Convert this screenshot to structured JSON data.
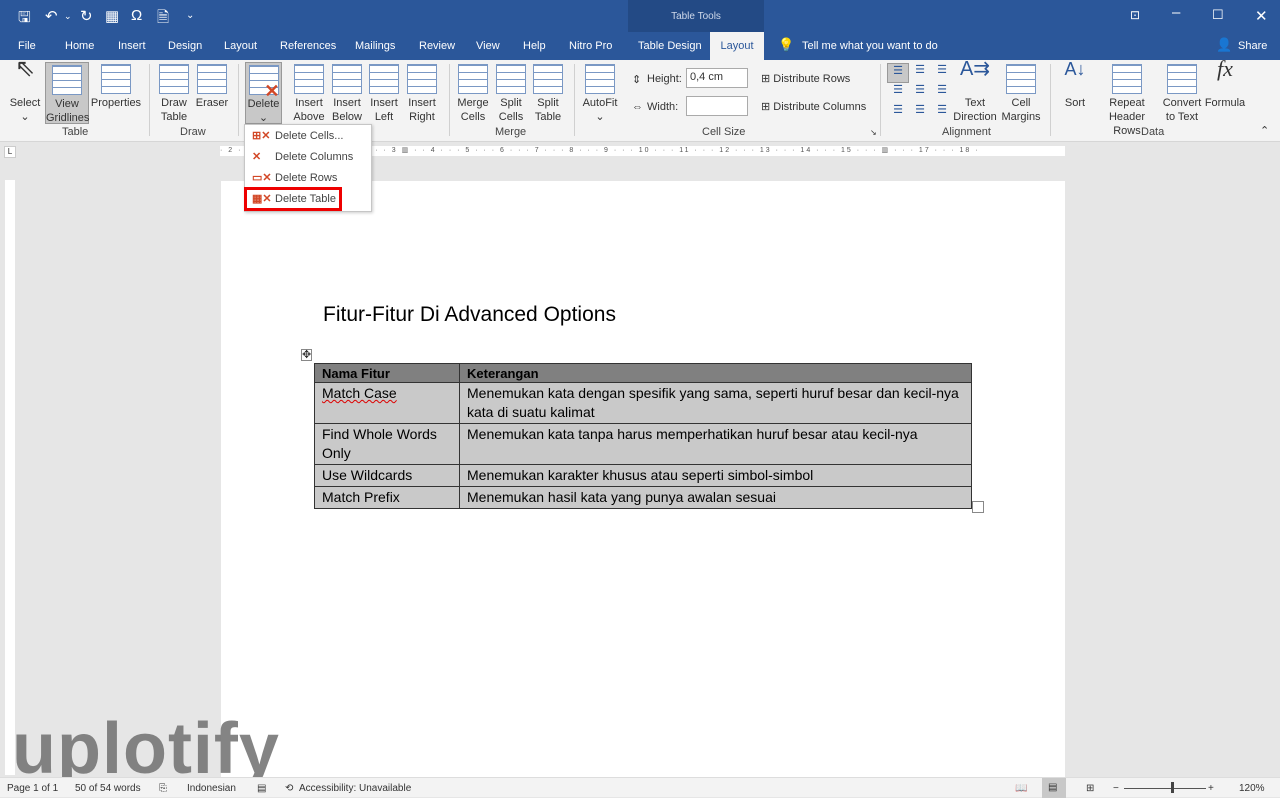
{
  "titlebar": {
    "context_tab": "Table Tools",
    "controls": [
      "restore-ribbon-icon",
      "minimize-icon",
      "maximize-icon",
      "close-icon"
    ]
  },
  "quick_access": [
    "save-icon",
    "undo-icon",
    "redo-icon",
    "table-icon",
    "omega-icon",
    "document-icon",
    "customize-icon"
  ],
  "tabs": [
    "File",
    "Home",
    "Insert",
    "Design",
    "Layout",
    "References",
    "Mailings",
    "Review",
    "View",
    "Help",
    "Nitro Pro",
    "Table Design",
    "Layout"
  ],
  "active_tab": "Layout",
  "tell_me": "Tell me what you want to do",
  "share": "Share",
  "ribbon": {
    "table": {
      "label": "Table",
      "select": "Select",
      "view_gridlines": "View Gridlines",
      "properties": "Properties"
    },
    "draw": {
      "label": "Draw",
      "draw_table": "Draw Table",
      "eraser": "Eraser"
    },
    "rows_cols": {
      "delete": "Delete",
      "insert_above": "Insert Above",
      "insert_below": "Insert Below",
      "insert_left": "Insert Left",
      "insert_right": "Insert Right"
    },
    "merge": {
      "label": "Merge",
      "merge_cells": "Merge Cells",
      "split_cells": "Split Cells",
      "split_table": "Split Table"
    },
    "cell_size": {
      "label": "Cell Size",
      "autofit": "AutoFit",
      "height_label": "Height:",
      "height_value": "0,4 cm",
      "width_label": "Width:",
      "width_value": "",
      "distribute_rows": "Distribute Rows",
      "distribute_columns": "Distribute Columns"
    },
    "alignment": {
      "label": "Alignment",
      "text_direction": "Text Direction",
      "cell_margins": "Cell Margins"
    },
    "data": {
      "label": "Data",
      "sort": "Sort",
      "repeat_header_rows": "Repeat Header Rows",
      "convert_to_text": "Convert to Text",
      "formula": "Formula"
    }
  },
  "delete_menu": [
    "Delete Cells...",
    "Delete Columns",
    "Delete Rows",
    "Delete Table"
  ],
  "ruler": "· 2 · · · 1 · · ·   · · · 1 · · · 2 · · · 3 ▥ · · 4 · · · 5 · · · 6 · · · 7 · · · 8 · · · 9 · · · 10 · · · 11 · · · 12 · · · 13 · · · 14 · · · 15 · · · ▥ · · · 17 · · · 18 ·",
  "document": {
    "title": "Fitur-Fitur Di Advanced Options",
    "table": {
      "headers": [
        "Nama Fitur",
        "Keterangan"
      ],
      "rows": [
        [
          "Match Case",
          "Menemukan kata dengan spesifik yang sama, seperti huruf besar dan kecil-nya kata di suatu kalimat"
        ],
        [
          "Find Whole Words Only",
          "Menemukan kata tanpa harus memperhatikan huruf besar atau kecil-nya"
        ],
        [
          "Use Wildcards",
          "Menemukan karakter khusus atau seperti simbol-simbol"
        ],
        [
          "Match Prefix",
          "Menemukan hasil kata yang punya awalan sesuai"
        ]
      ]
    }
  },
  "status": {
    "page": "Page 1 of 1",
    "words": "50 of 54 words",
    "language": "Indonesian",
    "accessibility": "Accessibility: Unavailable",
    "zoom": "120%"
  },
  "watermark": "uplotify",
  "colors": {
    "title_bar": "#2b579a",
    "highlight": "#e00000",
    "selection": "#c9c9c9"
  }
}
